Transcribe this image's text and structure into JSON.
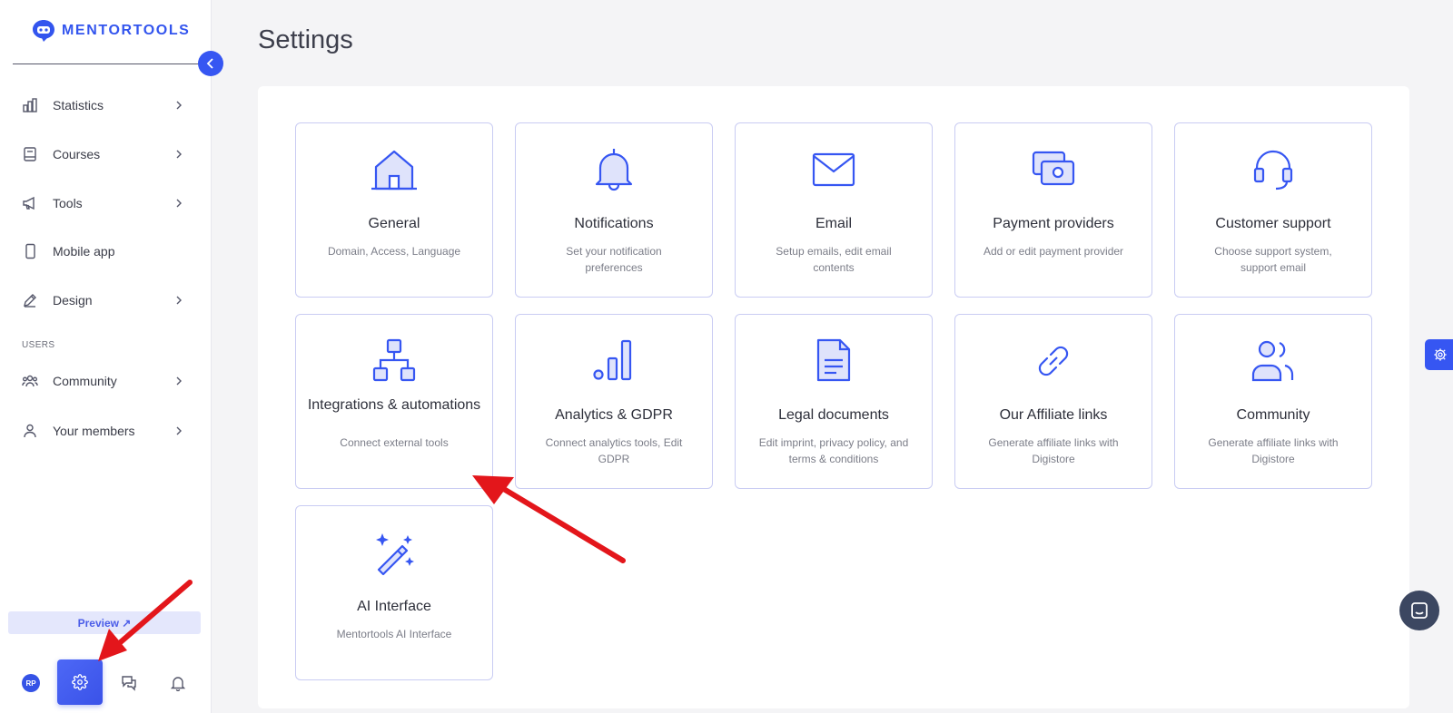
{
  "brand": {
    "name": "MENTORTOOLS",
    "color": "#3355ee"
  },
  "sidebar": {
    "items": [
      {
        "label": "Statistics",
        "icon": "bar-chart-icon",
        "has_chevron": true
      },
      {
        "label": "Courses",
        "icon": "book-icon",
        "has_chevron": true
      },
      {
        "label": "Tools",
        "icon": "megaphone-icon",
        "has_chevron": true
      },
      {
        "label": "Mobile app",
        "icon": "phone-icon",
        "has_chevron": false
      },
      {
        "label": "Design",
        "icon": "pencil-icon",
        "has_chevron": true
      }
    ],
    "section_users": "USERS",
    "user_items": [
      {
        "label": "Community",
        "icon": "people-icon",
        "has_chevron": true
      },
      {
        "label": "Your members",
        "icon": "person-icon",
        "has_chevron": true
      }
    ],
    "preview_label": "Preview ↗",
    "avatar_initials": "RP"
  },
  "page": {
    "title": "Settings"
  },
  "cards": [
    {
      "title": "General",
      "desc": "Domain, Access, Language",
      "icon": "home-icon"
    },
    {
      "title": "Notifications",
      "desc": "Set your notification preferences",
      "icon": "bell-icon"
    },
    {
      "title": "Email",
      "desc": "Setup emails, edit email contents",
      "icon": "envelope-icon"
    },
    {
      "title": "Payment providers",
      "desc": "Add or edit payment provider",
      "icon": "cash-icon"
    },
    {
      "title": "Customer support",
      "desc": "Choose support system, support email",
      "icon": "headset-icon"
    },
    {
      "title": "Integrations & automations",
      "desc": "Connect external tools",
      "icon": "hierarchy-icon"
    },
    {
      "title": "Analytics & GDPR",
      "desc": "Connect analytics tools, Edit GDPR",
      "icon": "analytics-icon"
    },
    {
      "title": "Legal documents",
      "desc": "Edit imprint, privacy policy, and terms & conditions",
      "icon": "document-icon"
    },
    {
      "title": "Our Affiliate links",
      "desc": "Generate affiliate links with Digistore",
      "icon": "link-icon"
    },
    {
      "title": "Community",
      "desc": "Generate affiliate links with Digistore",
      "icon": "users-icon"
    },
    {
      "title": "AI Interface",
      "desc": "Mentortools AI Interface",
      "icon": "magic-wand-icon"
    }
  ],
  "colors": {
    "accent": "#3656f2",
    "annotation_arrow": "#e3161b"
  }
}
